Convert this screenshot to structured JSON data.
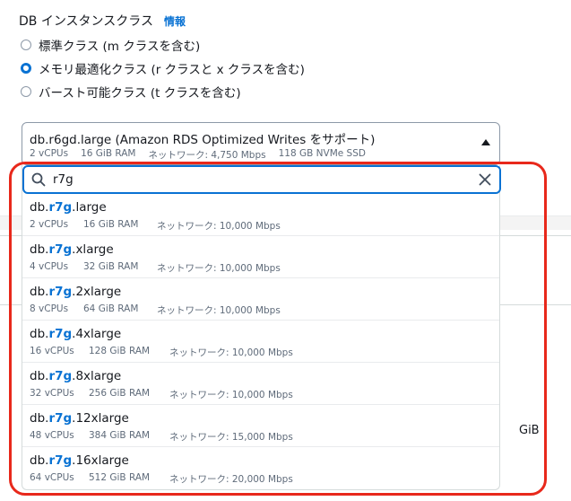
{
  "section": {
    "label": "DB インスタンスクラス",
    "info": "情報"
  },
  "radios": [
    {
      "label": "標準クラス (m クラスを含む)",
      "checked": false
    },
    {
      "label": "メモリ最適化クラス (r クラスと x クラスを含む)",
      "checked": true
    },
    {
      "label": "バースト可能クラス (t クラスを含む)",
      "checked": false
    }
  ],
  "selected": {
    "title": "db.r6gd.large (Amazon RDS Optimized Writes をサポート)",
    "vcpus": "2 vCPUs",
    "ram": "16 GiB RAM",
    "network": "ネットワーク: 4,750 Mbps",
    "ssd": "118 GB NVMe SSD"
  },
  "search": {
    "value": "r7g"
  },
  "options": [
    {
      "prefix": "db.",
      "match": "r7g",
      "suffix": ".large",
      "vcpus": "2 vCPUs",
      "ram": "16 GiB RAM",
      "network": "ネットワーク: 10,000 Mbps"
    },
    {
      "prefix": "db.",
      "match": "r7g",
      "suffix": ".xlarge",
      "vcpus": "4 vCPUs",
      "ram": "32 GiB RAM",
      "network": "ネットワーク: 10,000 Mbps"
    },
    {
      "prefix": "db.",
      "match": "r7g",
      "suffix": ".2xlarge",
      "vcpus": "8 vCPUs",
      "ram": "64 GiB RAM",
      "network": "ネットワーク: 10,000 Mbps"
    },
    {
      "prefix": "db.",
      "match": "r7g",
      "suffix": ".4xlarge",
      "vcpus": "16 vCPUs",
      "ram": "128 GiB RAM",
      "network": "ネットワーク: 10,000 Mbps"
    },
    {
      "prefix": "db.",
      "match": "r7g",
      "suffix": ".8xlarge",
      "vcpus": "32 vCPUs",
      "ram": "256 GiB RAM",
      "network": "ネットワーク: 10,000 Mbps"
    },
    {
      "prefix": "db.",
      "match": "r7g",
      "suffix": ".12xlarge",
      "vcpus": "48 vCPUs",
      "ram": "384 GiB RAM",
      "network": "ネットワーク: 15,000 Mbps"
    },
    {
      "prefix": "db.",
      "match": "r7g",
      "suffix": ".16xlarge",
      "vcpus": "64 vCPUs",
      "ram": "512 GiB RAM",
      "network": "ネットワーク: 20,000 Mbps"
    }
  ],
  "background": {
    "unit_label": "GiB"
  },
  "colors": {
    "accent": "#0972d3",
    "annotation": "#e8281b",
    "text": "#16191f",
    "muted": "#5f6b7a"
  }
}
